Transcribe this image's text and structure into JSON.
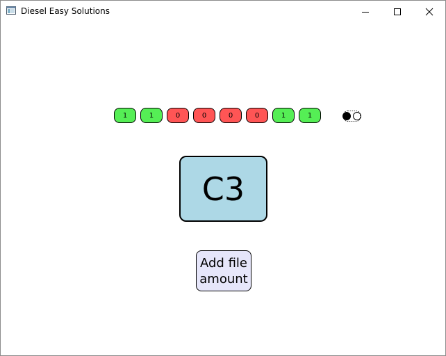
{
  "window": {
    "title": "Diesel Easy Solutions",
    "app_icon": "window-app-icon",
    "controls": [
      "minimize-icon",
      "maximize-icon",
      "close-icon"
    ]
  },
  "bits": [
    {
      "value": "1",
      "color": "#55ee55"
    },
    {
      "value": "1",
      "color": "#55ee55"
    },
    {
      "value": "0",
      "color": "#ff5555"
    },
    {
      "value": "0",
      "color": "#ff5555"
    },
    {
      "value": "0",
      "color": "#ff5555"
    },
    {
      "value": "0",
      "color": "#ff5555"
    },
    {
      "value": "1",
      "color": "#55ee55"
    },
    {
      "value": "1",
      "color": "#55ee55"
    }
  ],
  "radio_group": {
    "selected_index": 0,
    "count": 2
  },
  "code": "C3",
  "add_button_label": "Add file amount",
  "colors": {
    "code_box": "#add8e6",
    "add_button": "#e6e6fa"
  }
}
